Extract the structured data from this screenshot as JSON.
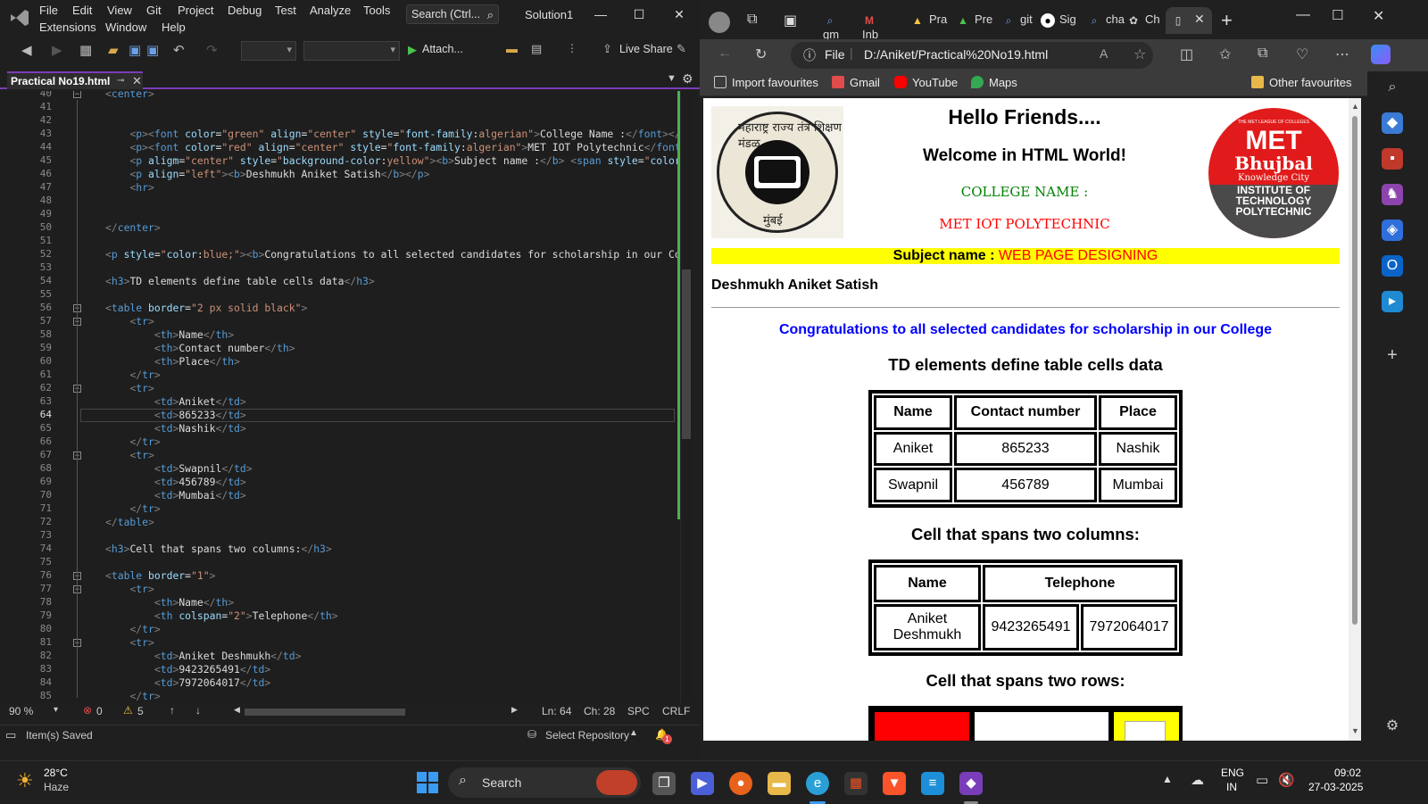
{
  "vs": {
    "menu": [
      "File",
      "Edit",
      "View",
      "Git",
      "Project",
      "Debug",
      "Test",
      "Analyze",
      "Tools",
      "Extensions",
      "Window",
      "Help"
    ],
    "search_label": "Search (Ctrl...",
    "solution_name": "Solution1",
    "toolbar": {
      "attach_label": "Attach...",
      "live_share_label": "Live Share"
    },
    "doc_tab": "Practical No19.html",
    "editor": {
      "lines": [
        {
          "n": "40",
          "html": "<span class='tg'>&lt;</span><span class='tn'>center</span><span class='tg'>&gt;</span>"
        },
        {
          "n": "41",
          "html": ""
        },
        {
          "n": "42",
          "html": ""
        },
        {
          "n": "43",
          "html": "    <span class='tg'>&lt;</span><span class='tn'>p</span><span class='tg'>&gt;&lt;</span><span class='tn'>font</span> <span class='at'>color</span>=<span class='av'>\"green\"</span> <span class='at'>align</span>=<span class='av'>\"center\"</span> <span class='at'>style</span>=<span class='av'>\"</span><span class='at'>font-family</span>:<span class='av'>algerian\"</span><span class='tg'>&gt;</span>College Name :<span class='tg'>&lt;/</span><span class='tn'>font</span><span class='tg'>&gt;&lt;/</span><span class='tn'>p</span>"
        },
        {
          "n": "44",
          "html": "    <span class='tg'>&lt;</span><span class='tn'>p</span><span class='tg'>&gt;&lt;</span><span class='tn'>font</span> <span class='at'>color</span>=<span class='av'>\"red\"</span> <span class='at'>align</span>=<span class='av'>\"center\"</span> <span class='at'>style</span>=<span class='av'>\"</span><span class='at'>font-family</span>:<span class='av'>algerian\"</span><span class='tg'>&gt;</span>MET IOT Polytechnic<span class='tg'>&lt;/</span><span class='tn'>font</span><span class='tg'>&gt;</span>"
        },
        {
          "n": "45",
          "html": "    <span class='tg'>&lt;</span><span class='tn'>p</span> <span class='at'>aligm</span>=<span class='av'>\"center\"</span> <span class='at'>style</span>=<span class='av'>\"</span><span class='at'>background-color</span>:<span class='av'>yellow\"</span><span class='tg'>&gt;&lt;</span><span class='tn'>b</span><span class='tg'>&gt;</span>Subject name :<span class='tg'>&lt;/</span><span class='tn'>b</span><span class='tg'>&gt;</span> <span class='tg'>&lt;</span><span class='tn'>span</span> <span class='at'>style</span>=<span class='av'>\"</span><span class='at'>color</span>:"
        },
        {
          "n": "46",
          "html": "    <span class='tg'>&lt;</span><span class='tn'>p</span> <span class='at'>align</span>=<span class='av'>\"left\"</span><span class='tg'>&gt;&lt;</span><span class='tn'>b</span><span class='tg'>&gt;</span>Deshmukh Aniket Satish<span class='tg'>&lt;/</span><span class='tn'>b</span><span class='tg'>&gt;&lt;/</span><span class='tn'>p</span><span class='tg'>&gt;</span>"
        },
        {
          "n": "47",
          "html": "    <span class='tg'>&lt;</span><span class='tn'>hr</span><span class='tg'>&gt;</span>"
        },
        {
          "n": "48",
          "html": ""
        },
        {
          "n": "49",
          "html": ""
        },
        {
          "n": "50",
          "html": "<span class='tg'>&lt;/</span><span class='tn'>center</span><span class='tg'>&gt;</span>"
        },
        {
          "n": "51",
          "html": ""
        },
        {
          "n": "52",
          "html": "<span class='tg'>&lt;</span><span class='tn'>p</span> <span class='at'>style</span>=<span class='av'>\"</span><span class='at'>color</span>:<span class='av'>blue;\"</span><span class='tg'>&gt;&lt;</span><span class='tn'>b</span><span class='tg'>&gt;</span>Congratulations to all selected candidates for scholarship in our Col"
        },
        {
          "n": "53",
          "html": ""
        },
        {
          "n": "54",
          "html": "<span class='tg'>&lt;</span><span class='tn'>h3</span><span class='tg'>&gt;</span>TD elements define table cells data<span class='tg'>&lt;/</span><span class='tn'>h3</span><span class='tg'>&gt;</span>"
        },
        {
          "n": "55",
          "html": ""
        },
        {
          "n": "56",
          "html": "<span class='tg'>&lt;</span><span class='tn'>table</span> <span class='at'>border</span>=<span class='av'>\"2 px solid black\"</span><span class='tg'>&gt;</span>"
        },
        {
          "n": "57",
          "html": "    <span class='tg'>&lt;</span><span class='tn'>tr</span><span class='tg'>&gt;</span>"
        },
        {
          "n": "58",
          "html": "        <span class='tg'>&lt;</span><span class='tn'>th</span><span class='tg'>&gt;</span>Name<span class='tg'>&lt;/</span><span class='tn'>th</span><span class='tg'>&gt;</span>"
        },
        {
          "n": "59",
          "html": "        <span class='tg'>&lt;</span><span class='tn'>th</span><span class='tg'>&gt;</span>Contact number<span class='tg'>&lt;/</span><span class='tn'>th</span><span class='tg'>&gt;</span>"
        },
        {
          "n": "60",
          "html": "        <span class='tg'>&lt;</span><span class='tn'>th</span><span class='tg'>&gt;</span>Place<span class='tg'>&lt;/</span><span class='tn'>th</span><span class='tg'>&gt;</span>"
        },
        {
          "n": "61",
          "html": "    <span class='tg'>&lt;/</span><span class='tn'>tr</span><span class='tg'>&gt;</span>"
        },
        {
          "n": "62",
          "html": "    <span class='tg'>&lt;</span><span class='tn'>tr</span><span class='tg'>&gt;</span>"
        },
        {
          "n": "63",
          "html": "        <span class='tg'>&lt;</span><span class='tn'>td</span><span class='tg'>&gt;</span>Aniket<span class='tg'>&lt;/</span><span class='tn'>td</span><span class='tg'>&gt;</span>"
        },
        {
          "n": "64",
          "html": "        <span class='tg'>&lt;</span><span class='tn'>td</span><span class='tg'>&gt;</span>865233<span class='tg'>&lt;/</span><span class='tn'>td</span><span class='tg'>&gt;</span>"
        },
        {
          "n": "65",
          "html": "        <span class='tg'>&lt;</span><span class='tn'>td</span><span class='tg'>&gt;</span>Nashik<span class='tg'>&lt;/</span><span class='tn'>td</span><span class='tg'>&gt;</span>"
        },
        {
          "n": "66",
          "html": "    <span class='tg'>&lt;/</span><span class='tn'>tr</span><span class='tg'>&gt;</span>"
        },
        {
          "n": "67",
          "html": "    <span class='tg'>&lt;</span><span class='tn'>tr</span><span class='tg'>&gt;</span>"
        },
        {
          "n": "68",
          "html": "        <span class='tg'>&lt;</span><span class='tn'>td</span><span class='tg'>&gt;</span>Swapnil<span class='tg'>&lt;/</span><span class='tn'>td</span><span class='tg'>&gt;</span>"
        },
        {
          "n": "69",
          "html": "        <span class='tg'>&lt;</span><span class='tn'>td</span><span class='tg'>&gt;</span>456789<span class='tg'>&lt;/</span><span class='tn'>td</span><span class='tg'>&gt;</span>"
        },
        {
          "n": "70",
          "html": "        <span class='tg'>&lt;</span><span class='tn'>td</span><span class='tg'>&gt;</span>Mumbai<span class='tg'>&lt;/</span><span class='tn'>td</span><span class='tg'>&gt;</span>"
        },
        {
          "n": "71",
          "html": "    <span class='tg'>&lt;/</span><span class='tn'>tr</span><span class='tg'>&gt;</span>"
        },
        {
          "n": "72",
          "html": "<span class='tg'>&lt;/</span><span class='tn'>table</span><span class='tg'>&gt;</span>"
        },
        {
          "n": "73",
          "html": ""
        },
        {
          "n": "74",
          "html": "<span class='tg'>&lt;</span><span class='tn'>h3</span><span class='tg'>&gt;</span>Cell that spans two columns:<span class='tg'>&lt;/</span><span class='tn'>h3</span><span class='tg'>&gt;</span>"
        },
        {
          "n": "75",
          "html": ""
        },
        {
          "n": "76",
          "html": "<span class='tg'>&lt;</span><span class='tn'>table</span> <span class='at'>border</span>=<span class='av'>\"1\"</span><span class='tg'>&gt;</span>"
        },
        {
          "n": "77",
          "html": "    <span class='tg'>&lt;</span><span class='tn'>tr</span><span class='tg'>&gt;</span>"
        },
        {
          "n": "78",
          "html": "        <span class='tg'>&lt;</span><span class='tn'>th</span><span class='tg'>&gt;</span>Name<span class='tg'>&lt;/</span><span class='tn'>th</span><span class='tg'>&gt;</span>"
        },
        {
          "n": "79",
          "html": "        <span class='tg'>&lt;</span><span class='tn'>th</span> <span class='at'>colspan</span>=<span class='av'>\"2\"</span><span class='tg'>&gt;</span>Telephone<span class='tg'>&lt;/</span><span class='tn'>th</span><span class='tg'>&gt;</span>"
        },
        {
          "n": "80",
          "html": "    <span class='tg'>&lt;/</span><span class='tn'>tr</span><span class='tg'>&gt;</span>"
        },
        {
          "n": "81",
          "html": "    <span class='tg'>&lt;</span><span class='tn'>tr</span><span class='tg'>&gt;</span>"
        },
        {
          "n": "82",
          "html": "        <span class='tg'>&lt;</span><span class='tn'>td</span><span class='tg'>&gt;</span>Aniket Deshmukh<span class='tg'>&lt;/</span><span class='tn'>td</span><span class='tg'>&gt;</span>"
        },
        {
          "n": "83",
          "html": "        <span class='tg'>&lt;</span><span class='tn'>td</span><span class='tg'>&gt;</span>9423265491<span class='tg'>&lt;/</span><span class='tn'>td</span><span class='tg'>&gt;</span>"
        },
        {
          "n": "84",
          "html": "        <span class='tg'>&lt;</span><span class='tn'>td</span><span class='tg'>&gt;</span>7972064017<span class='tg'>&lt;/</span><span class='tn'>td</span><span class='tg'>&gt;</span>"
        },
        {
          "n": "85",
          "html": "    <span class='tg'>&lt;/</span><span class='tn'>tr</span><span class='tg'>&gt;</span>"
        }
      ],
      "current_line": "64"
    },
    "status": {
      "zoom": "90 %",
      "errors": "0",
      "warnings": "5",
      "ln": "Ln: 64",
      "ch": "Ch: 28",
      "spc": "SPC",
      "crlf": "CRLF",
      "saved": "Item(s) Saved",
      "select_repo": "Select Repository",
      "notifications": "1"
    }
  },
  "edge": {
    "tabs": [
      "gm",
      "Inb",
      "Pra",
      "Pre",
      "git",
      "Sig",
      "cha",
      "Ch"
    ],
    "url_prefix": "File",
    "url": "D:/Aniket/Practical%20No19.html",
    "bookmarks": [
      "Import favourites",
      "Gmail",
      "YouTube",
      "Maps"
    ],
    "other_favourites": "Other favourites"
  },
  "page": {
    "hello": "Hello Friends....",
    "welcome": "Welcome in HTML World!",
    "college_label": "COLLEGE NAME :",
    "college_name": "MET IOT POLYTECHNIC",
    "subject_label": "Subject name :",
    "subject_value": "WEB PAGE DESIGNING",
    "student": "Deshmukh Aniket Satish",
    "congrats": "Congratulations to all selected candidates for scholarship in our College",
    "h3_td": "TD elements define table cells data",
    "table1": {
      "headers": [
        "Name",
        "Contact number",
        "Place"
      ],
      "rows": [
        [
          "Aniket",
          "865233",
          "Nashik"
        ],
        [
          "Swapnil",
          "456789",
          "Mumbai"
        ]
      ]
    },
    "h3_colspan": "Cell that spans two columns:",
    "table2": {
      "headers": [
        "Name",
        "Telephone"
      ],
      "row": [
        "Aniket Deshmukh",
        "9423265491",
        "7972064017"
      ]
    },
    "h3_rowspan": "Cell that spans two rows:",
    "seal_text_top": "महाराष्ट्र राज्य तंत्र शिक्षण मंडळ",
    "seal_text_bottom": "मुंबई",
    "met_logo": {
      "tagline": "THE MET LEAGUE OF COLLEGES",
      "brand": "MET",
      "sub": "Bhujbal",
      "knowledge": "Knowledge City",
      "inst1": "INSTITUTE OF",
      "inst2": "TECHNOLOGY",
      "inst3": "POLYTECHNIC"
    }
  },
  "taskbar": {
    "temp": "28°C",
    "weather": "Haze",
    "search": "Search",
    "lang1": "ENG",
    "lang2": "IN",
    "time": "09:02",
    "date": "27-03-2025"
  }
}
